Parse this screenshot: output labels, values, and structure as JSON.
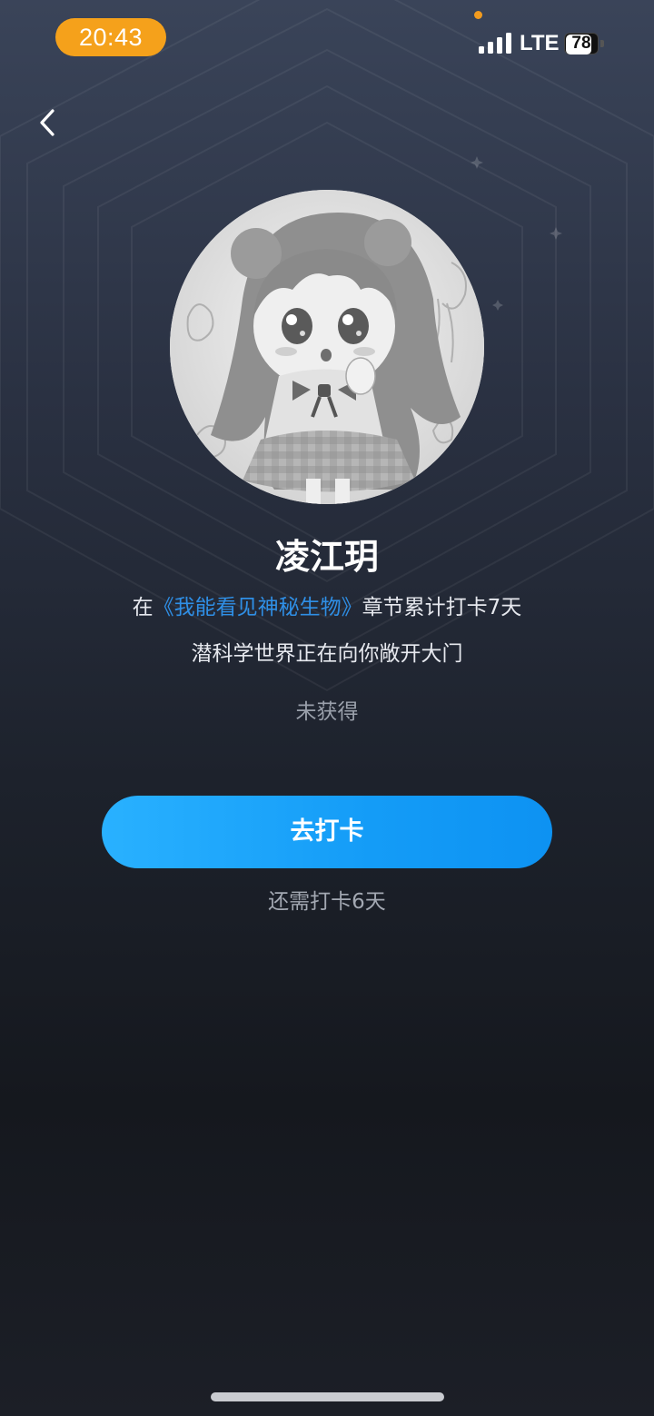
{
  "status_bar": {
    "time": "20:43",
    "network": "LTE",
    "battery_percent": "78",
    "battery_level": 0.78,
    "signal_bars": 4,
    "time_pill_color": "#f5a11b"
  },
  "nav": {
    "back_icon": "chevron-left-icon"
  },
  "badge": {
    "name": "凌江玥",
    "desc_prefix": "在",
    "book_title": "《我能看见神秘生物》",
    "desc_suffix": "章节累计打卡7天",
    "subtitle": "潜科学世界正在向你敞开大门",
    "status": "未获得"
  },
  "action": {
    "button_label": "去打卡",
    "remaining": "还需打卡6天",
    "button_color": "#149cf7"
  },
  "colors": {
    "link": "#2f8fe6",
    "background_top": "#3a4459",
    "background_bottom": "#15181e"
  }
}
